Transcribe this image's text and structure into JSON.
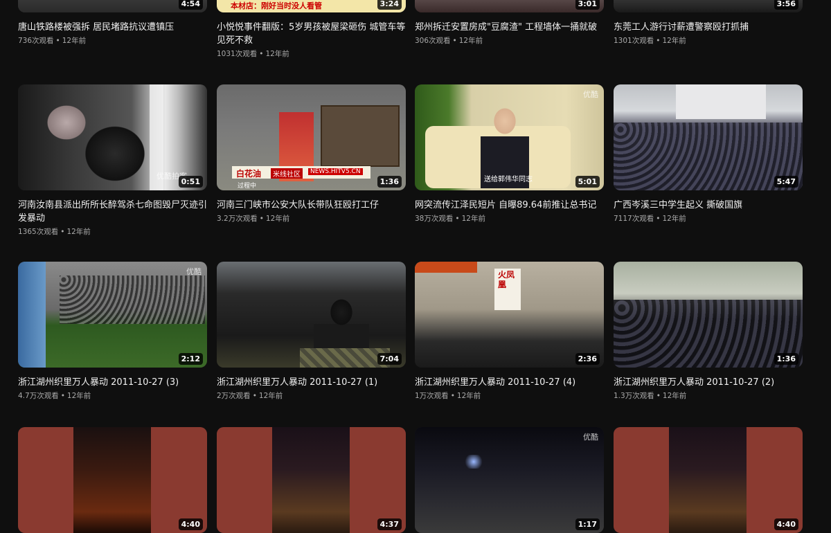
{
  "videos": [
    {
      "title": "唐山铁路楼被强拆 居民堵路抗议遭镇压",
      "views": "736次观看",
      "age": "12年前",
      "duration": "4:54"
    },
    {
      "title": "小悦悦事件翻版：5岁男孩被屋梁砸伤 城管车等见死不救",
      "views": "1031次观看",
      "age": "12年前",
      "duration": "3:24",
      "caption": "本材店：刚好当时没人看管"
    },
    {
      "title": "郑州拆迁安置房成\"豆腐渣\" 工程墙体一捅就破",
      "views": "306次观看",
      "age": "12年前",
      "duration": "3:01"
    },
    {
      "title": "东莞工人游行讨薪遭警察殴打抓捕",
      "views": "1301次观看",
      "age": "12年前",
      "duration": "3:56"
    },
    {
      "title": "河南汝南县派出所所长醉驾杀七命图毁尸灭迹引发暴动",
      "views": "1365次观看",
      "age": "12年前",
      "duration": "0:51",
      "watermark": "优酷拍客"
    },
    {
      "title": "河南三门峡市公安大队长带队狂殴打工仔",
      "views": "3.2万次观看",
      "age": "12年前",
      "duration": "1:36",
      "caption_a": "白花油",
      "caption_b": "米线社区",
      "caption_c": "NEWS.HITV5.CN",
      "caption_d": "过程中"
    },
    {
      "title": "网突流传江泽民短片 自曝89.64前推让总书记",
      "views": "38万次观看",
      "age": "12年前",
      "duration": "5:01",
      "caption": "送给郭伟华同志",
      "watermark": "优酷"
    },
    {
      "title": "广西岑溪三中学生起义 撕破国旗",
      "views": "7117次观看",
      "age": "12年前",
      "duration": "5:47"
    },
    {
      "title": "浙江湖州织里万人暴动 2011-10-27 (3)",
      "views": "4.7万次观看",
      "age": "12年前",
      "duration": "2:12",
      "watermark": "优酷"
    },
    {
      "title": "浙江湖州织里万人暴动 2011-10-27 (1)",
      "views": "2万次观看",
      "age": "12年前",
      "duration": "7:04"
    },
    {
      "title": "浙江湖州织里万人暴动 2011-10-27 (4)",
      "views": "1万次观看",
      "age": "12年前",
      "duration": "2:36",
      "sign": "火凤凰"
    },
    {
      "title": "浙江湖州织里万人暴动 2011-10-27 (2)",
      "views": "1.3万次观看",
      "age": "12年前",
      "duration": "1:36"
    },
    {
      "title": "",
      "views": "",
      "age": "",
      "duration": "4:40"
    },
    {
      "title": "",
      "views": "",
      "age": "",
      "duration": "4:37"
    },
    {
      "title": "",
      "views": "",
      "age": "",
      "duration": "1:17",
      "watermark": "优酷"
    },
    {
      "title": "",
      "views": "",
      "age": "",
      "duration": "4:40"
    }
  ],
  "meta_separator": "•"
}
